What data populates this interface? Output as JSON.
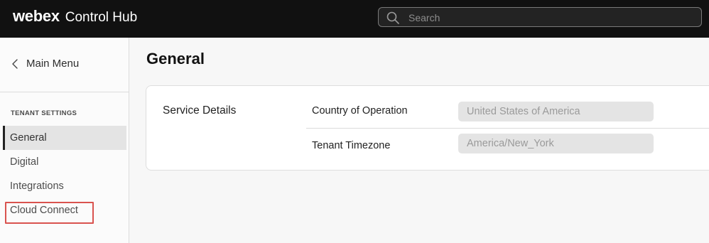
{
  "app": {
    "logo": "webex",
    "name": "Control Hub"
  },
  "search": {
    "placeholder": "Search",
    "icon": "search-icon"
  },
  "sidebar": {
    "back_label": "Main Menu",
    "back_icon": "chevron-left-icon",
    "section_title": "TENANT SETTINGS",
    "items": [
      {
        "label": "General",
        "active": true
      },
      {
        "label": "Digital",
        "active": false
      },
      {
        "label": "Integrations",
        "active": false
      },
      {
        "label": "Cloud Connect",
        "active": false,
        "highlighted": true
      }
    ]
  },
  "main": {
    "title": "General",
    "card": {
      "title": "Service Details",
      "rows": [
        {
          "label": "Country of Operation",
          "value": "United States of America"
        },
        {
          "label": "Tenant Timezone",
          "value": "America/New_York"
        }
      ]
    }
  },
  "colors": {
    "topbar": "#111111",
    "highlight": "#d9534f",
    "active_nav": "#e4e4e4"
  }
}
